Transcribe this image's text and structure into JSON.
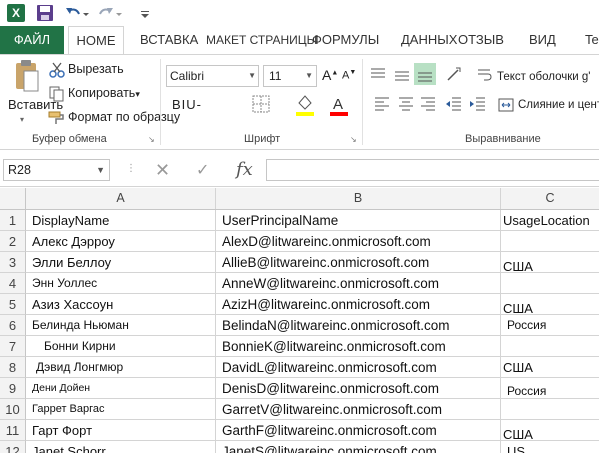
{
  "qat": {
    "app_icon": "X",
    "icons": [
      "excel-logo",
      "save-icon",
      "undo-icon",
      "redo-icon"
    ]
  },
  "tabs": {
    "file": "ФАЙЛ",
    "home": "HOME",
    "insert": "ВСТАВКА",
    "page_layout": "МАКЕТ СТРАНИЦЫ",
    "formulas": "ФОРМУЛЫ",
    "data": "ДАННЫХ",
    "review": "ОТЗЫВ",
    "view": "ВИД",
    "team": "Tea"
  },
  "ribbon": {
    "clipboard": {
      "paste": "Вставить",
      "cut": "Вырезать",
      "copy": "Копировать",
      "copy_dd": "▾",
      "format_painter": "Формат по образцу",
      "group_label": "Буфер обмена"
    },
    "font": {
      "name": "Calibri",
      "size": "11",
      "biu": "BIU-",
      "group_label": "Шрифт",
      "fill_color": "#ffff00",
      "font_color": "#ff0000"
    },
    "alignment": {
      "wrap_text": "Текст оболочки g'",
      "merge": "Слияние и цент",
      "group_label": "Выравнивание"
    }
  },
  "formula_bar": {
    "name_box": "R28",
    "fx": "fx",
    "formula": ""
  },
  "columns": [
    "A",
    "B",
    "C"
  ],
  "rows": [
    {
      "n": "1",
      "a": "DisplayName",
      "b": "UserPrincipalName",
      "c": "UsageLocation"
    },
    {
      "n": "2",
      "a": "Алекс Дэрроу",
      "b": "AlexD@litwareinc.onmicrosoft.com",
      "c": ""
    },
    {
      "n": "3",
      "a": "Элли Беллоу",
      "b": "AllieB@litwareinc.onmicrosoft.com",
      "c": "США"
    },
    {
      "n": "4",
      "a": "Энн Уоллес",
      "b": "AnneW@litwareinc.onmicrosoft.com",
      "c": ""
    },
    {
      "n": "5",
      "a": "Азиз Хассоун",
      "b": "AzizH@litwareinc.onmicrosoft.com",
      "c": "США"
    },
    {
      "n": "6",
      "a": "Белинда Ньюман",
      "b": "BelindaN@litwareinc.onmicrosoft.com",
      "c": "Россия"
    },
    {
      "n": "7",
      "a": "Бонни Кирни",
      "b": "BonnieK@litwareinc.onmicrosoft.com",
      "c": ""
    },
    {
      "n": "8",
      "a": "Дэвид Лонгмюр",
      "b": "DavidL@litwareinc.onmicrosoft.com",
      "c": "США"
    },
    {
      "n": "9",
      "a": "Дени Дойен",
      "b": "DenisD@litwareinc.onmicrosoft.com",
      "c": "Россия"
    },
    {
      "n": "10",
      "a": "Гаррет Варгас",
      "b": "GarretV@litwareinc.onmicrosoft.com",
      "c": ""
    },
    {
      "n": "11",
      "a": "Гарт Форт",
      "b": "GarthF@litwareinc.onmicrosoft.com",
      "c": "США"
    },
    {
      "n": "12",
      "a": "Janet Schorr",
      "b": "JanetS@litwareinc.onmicrosoft.com",
      "c": "US"
    }
  ],
  "colors": {
    "accent": "#217346",
    "grid_line": "#d4d4d4",
    "header_bg": "#f3f3f3"
  }
}
